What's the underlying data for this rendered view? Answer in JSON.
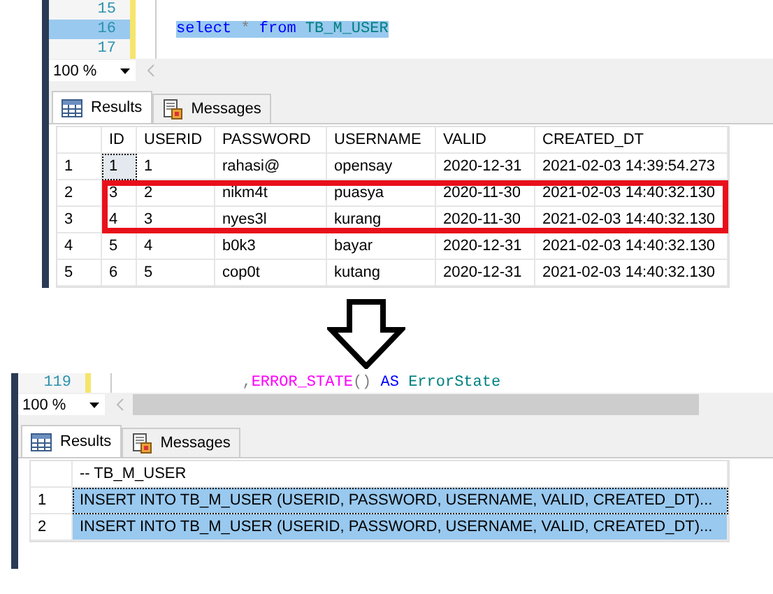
{
  "top_pane": {
    "editor_lines": [
      {
        "number": "15",
        "selected": false
      },
      {
        "number": "16",
        "selected": true,
        "tokens": [
          {
            "text": "select",
            "kind": "keyword"
          },
          {
            "text": " * ",
            "kind": "operator"
          },
          {
            "text": "from",
            "kind": "keyword"
          },
          {
            "text": " TB_M_USER",
            "kind": "identifier"
          }
        ]
      },
      {
        "number": "17",
        "selected": false
      }
    ],
    "zoom": "100 %",
    "tabs": [
      {
        "label": "Results",
        "selected": true
      },
      {
        "label": "Messages",
        "selected": false
      }
    ],
    "grid": {
      "columns": [
        "ID",
        "USERID",
        "PASSWORD",
        "USERNAME",
        "VALID",
        "CREATED_DT"
      ],
      "rows": [
        {
          "number": "1",
          "highlighted": false,
          "selected": false,
          "cells": [
            {
              "text": "1",
              "focused": true
            },
            {
              "text": "1",
              "focused": false
            },
            {
              "text": "rahasi@",
              "focused": false
            },
            {
              "text": "opensay",
              "focused": false
            },
            {
              "text": "2020-12-31",
              "focused": false
            },
            {
              "text": "2021-02-03 14:39:54.273",
              "focused": false
            }
          ]
        },
        {
          "number": "2",
          "highlighted": true,
          "selected": false,
          "cells": [
            {
              "text": "3",
              "focused": false
            },
            {
              "text": "2",
              "focused": false
            },
            {
              "text": "nikm4t",
              "focused": false
            },
            {
              "text": "puasya",
              "focused": false
            },
            {
              "text": "2020-11-30",
              "focused": false
            },
            {
              "text": "2021-02-03 14:40:32.130",
              "focused": false
            }
          ]
        },
        {
          "number": "3",
          "highlighted": true,
          "selected": false,
          "cells": [
            {
              "text": "4",
              "focused": false
            },
            {
              "text": "3",
              "focused": false
            },
            {
              "text": "nyes3l",
              "focused": false
            },
            {
              "text": "kurang",
              "focused": false
            },
            {
              "text": "2020-11-30",
              "focused": false
            },
            {
              "text": "2021-02-03 14:40:32.130",
              "focused": false
            }
          ]
        },
        {
          "number": "4",
          "highlighted": false,
          "selected": false,
          "cells": [
            {
              "text": "5",
              "focused": false
            },
            {
              "text": "4",
              "focused": false
            },
            {
              "text": "b0k3",
              "focused": false
            },
            {
              "text": "bayar",
              "focused": false
            },
            {
              "text": "2020-12-31",
              "focused": false
            },
            {
              "text": "2021-02-03 14:40:32.130",
              "focused": false
            }
          ]
        },
        {
          "number": "5",
          "highlighted": false,
          "selected": false,
          "cells": [
            {
              "text": "6",
              "focused": false
            },
            {
              "text": "5",
              "focused": false
            },
            {
              "text": "cop0t",
              "focused": false
            },
            {
              "text": "kutang",
              "focused": false
            },
            {
              "text": "2020-12-31",
              "focused": false
            },
            {
              "text": "2021-02-03 14:40:32.130",
              "focused": false
            }
          ]
        }
      ]
    }
  },
  "bottom_pane": {
    "editor_lines": [
      {
        "number": "119",
        "selected": false,
        "tokens": [
          {
            "text": "            ,",
            "kind": "operator"
          },
          {
            "text": "ERROR_STATE",
            "kind": "function"
          },
          {
            "text": "() ",
            "kind": "operator"
          },
          {
            "text": "AS",
            "kind": "keyword"
          },
          {
            "text": " ErrorState",
            "kind": "identifier"
          }
        ]
      }
    ],
    "zoom": "100 %",
    "tabs": [
      {
        "label": "Results",
        "selected": true
      },
      {
        "label": "Messages",
        "selected": false
      }
    ],
    "grid": {
      "columns": [
        "-- TB_M_USER"
      ],
      "rows": [
        {
          "number": "1",
          "selected": true,
          "cells": [
            {
              "text": "INSERT INTO TB_M_USER (USERID, PASSWORD, USERNAME, VALID, CREATED_DT)...",
              "focused": true
            }
          ]
        },
        {
          "number": "2",
          "selected": true,
          "cells": [
            {
              "text": "INSERT INTO TB_M_USER (USERID, PASSWORD, USERNAME, VALID, CREATED_DT)...",
              "focused": false
            }
          ]
        }
      ]
    }
  }
}
